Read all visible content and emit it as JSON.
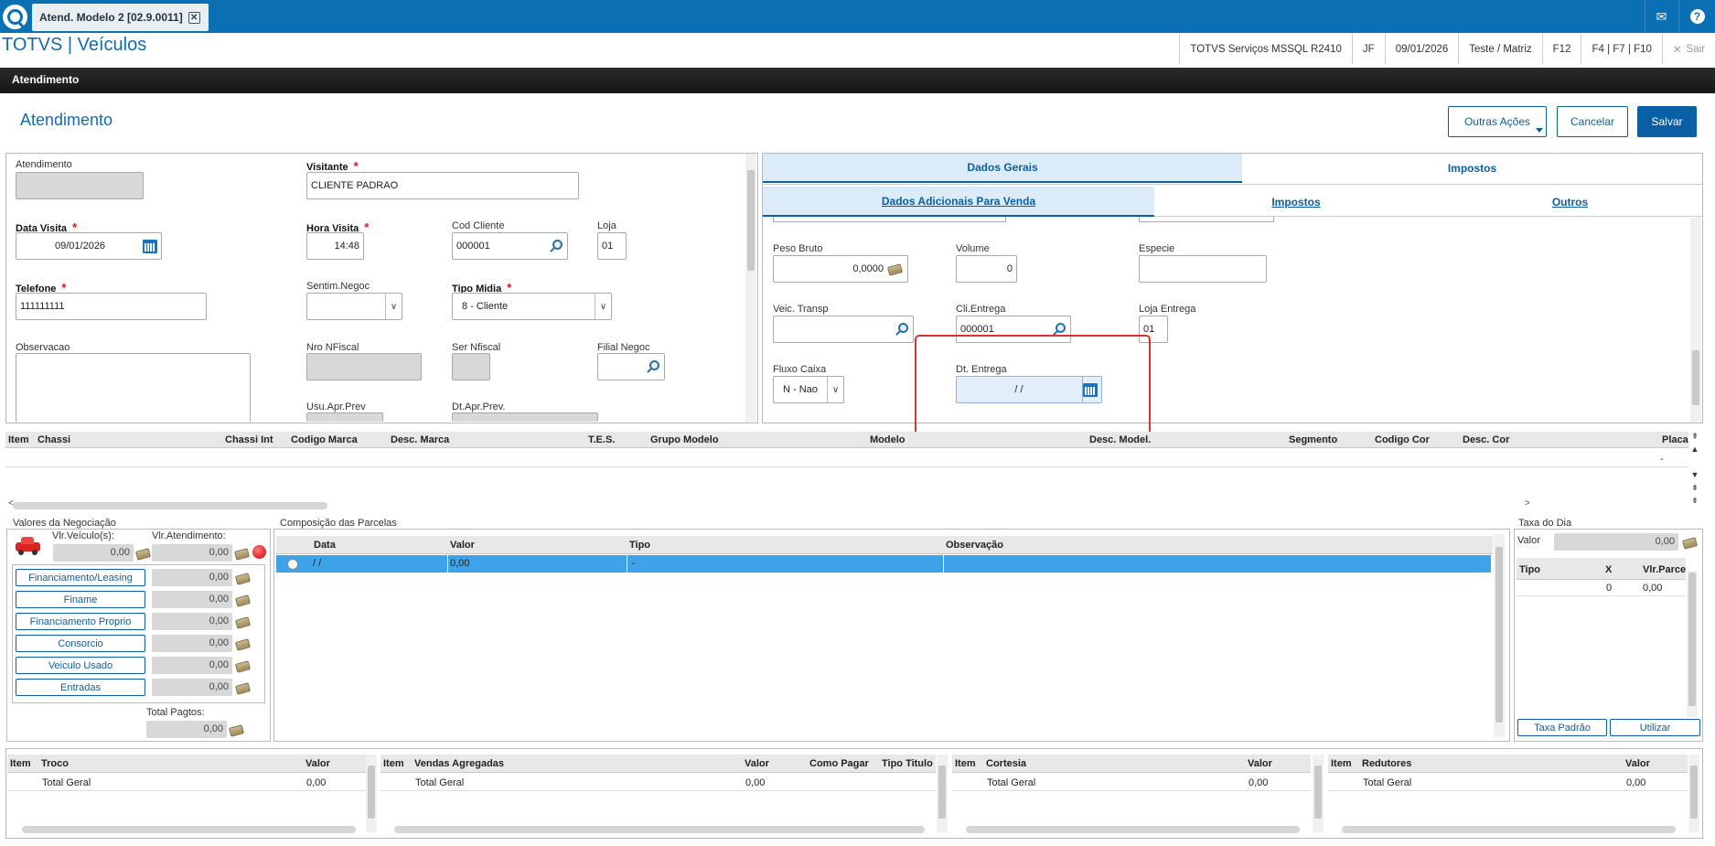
{
  "topbar": {
    "tab_label": "Atend. Modelo 2 [02.9.0011]",
    "tab_close": "✕",
    "mail": "✉",
    "help": "?"
  },
  "brand": "TOTVS | Veículos",
  "infobar": [
    "TOTVS Serviços MSSQL R2410",
    "JF",
    "09/01/2026",
    "Teste / Matriz",
    "F12",
    "F4 | F7 | F10",
    "Sair"
  ],
  "section": "Atendimento",
  "page_title": "Atendimento",
  "actions": {
    "outras": "Outras Ações",
    "cancelar": "Cancelar",
    "salvar": "Salvar"
  },
  "left_form": {
    "atendimento": {
      "label": "Atendimento",
      "value": ""
    },
    "visitante": {
      "label": "Visitante",
      "value": "CLIENTE PADRAO"
    },
    "data_visita": {
      "label": "Data Visita",
      "value": "09/01/2026"
    },
    "hora_visita": {
      "label": "Hora Visita",
      "value": "14:48"
    },
    "cod_cliente": {
      "label": "Cod Cliente",
      "value": "000001"
    },
    "loja": {
      "label": "Loja",
      "value": "01"
    },
    "telefone": {
      "label": "Telefone",
      "value": "111111111"
    },
    "sentim": {
      "label": "Sentim.Negoc",
      "value": ""
    },
    "tipo_midia": {
      "label": "Tipo Midia",
      "value": "8 - Cliente"
    },
    "observacao": {
      "label": "Observacao",
      "value": ""
    },
    "nro_nfiscal": {
      "label": "Nro NFiscal",
      "value": ""
    },
    "ser_nfiscal": {
      "label": "Ser Nfiscal",
      "value": ""
    },
    "filial_negoc": {
      "label": "Filial Negoc",
      "value": ""
    },
    "usu_apr": {
      "label": "Usu.Apr.Prev"
    },
    "dt_apr": {
      "label": "Dt.Apr.Prev."
    },
    "required": "*"
  },
  "right_tabs": {
    "row1": [
      "Dados Gerais",
      "Impostos"
    ],
    "row2": [
      "Dados Adicionais Para Venda",
      "Impostos",
      "Outros"
    ]
  },
  "right_form": {
    "peso_bruto": {
      "label": "Peso Bruto",
      "value": "0,0000"
    },
    "volume": {
      "label": "Volume",
      "value": "0"
    },
    "especie": {
      "label": "Especie",
      "value": ""
    },
    "veic_transp": {
      "label": "Veic. Transp",
      "value": ""
    },
    "cli_entrega": {
      "label": "Cli.Entrega",
      "value": "000001"
    },
    "loja_entrega": {
      "label": "Loja Entrega",
      "value": "01"
    },
    "fluxo_caixa": {
      "label": "Fluxo Caixa",
      "value": "N - Nao"
    },
    "dt_entrega": {
      "label": "Dt. Entrega",
      "value": "/ /"
    }
  },
  "vehicle_grid": {
    "columns": [
      "Item",
      "Chassi",
      "Chassi Int",
      "Codigo Marca",
      "Desc. Marca",
      "T.E.S.",
      "Grupo Modelo",
      "Modelo",
      "Desc. Model.",
      "Segmento",
      "Codigo Cor",
      "Desc. Cor",
      "Placa"
    ],
    "row_placa": "-"
  },
  "valores": {
    "title": "Valores da Negociação",
    "vlr_veiculo_label": "Vlr.Veículo(s):",
    "vlr_veiculo": "0,00",
    "vlr_atend_label": "Vlr.Atendimento:",
    "vlr_atend": "0,00",
    "items": [
      {
        "label": "Financiamento/Leasing",
        "value": "0,00"
      },
      {
        "label": "Finame",
        "value": "0,00"
      },
      {
        "label": "Financiamento Proprio",
        "value": "0,00"
      },
      {
        "label": "Consorcio",
        "value": "0,00"
      },
      {
        "label": "Veiculo Usado",
        "value": "0,00"
      },
      {
        "label": "Entradas",
        "value": "0,00"
      }
    ],
    "total_label": "Total Pagtos:",
    "total": "0,00"
  },
  "parcelas": {
    "title": "Composição das Parcelas",
    "columns": [
      "Data",
      "Valor",
      "Tipo",
      "Observação"
    ],
    "row": [
      "/ /",
      "0,00",
      "-",
      ""
    ]
  },
  "taxa": {
    "title": "Taxa do Dia",
    "valor_label": "Valor",
    "valor": "0,00",
    "columns": [
      "Tipo",
      "X",
      "Vlr.Parce"
    ],
    "row": [
      "",
      "0",
      "0,00"
    ],
    "btn_padrao": "Taxa Padrão",
    "btn_utilizar": "Utilizar"
  },
  "bottom_grids": {
    "troco": {
      "columns": [
        "Item",
        "Troco",
        "Valor"
      ],
      "row": [
        "",
        "Total Geral",
        "0,00"
      ]
    },
    "vendas": {
      "columns": [
        "Item",
        "Vendas Agregadas",
        "Valor",
        "Como Pagar",
        "Tipo Titulo"
      ],
      "row": [
        "",
        "Total Geral",
        "0,00"
      ]
    },
    "cortesia": {
      "columns": [
        "Item",
        "Cortesia",
        "Valor"
      ],
      "row": [
        "",
        "Total Geral",
        "0,00"
      ]
    },
    "redutores": {
      "columns": [
        "Item",
        "Redutores",
        "Valor"
      ],
      "row": [
        "",
        "Total Geral",
        "0,00"
      ]
    }
  },
  "colors": {
    "brand_blue": "#0b6fb3",
    "highlight_red": "#e03030",
    "selected_row": "#3ea3e8"
  }
}
